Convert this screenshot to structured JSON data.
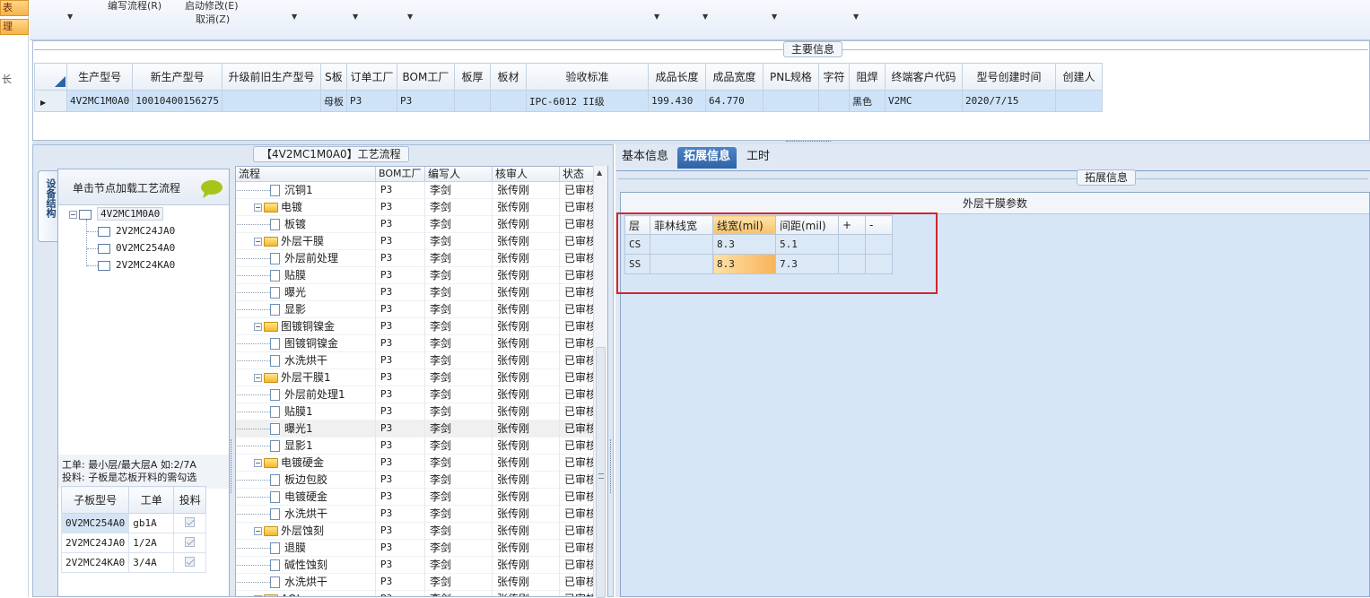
{
  "left_strip": {
    "item1": "表",
    "item2": "理",
    "item3": "长"
  },
  "toolbar": {
    "edit_flow": "编写流程(R)",
    "start_modify": "启动修改(E)",
    "cancel": "取消(Z)"
  },
  "main_info": {
    "title": "主要信息",
    "columns": [
      "生产型号",
      "新生产型号",
      "升级前旧生产型号",
      "S板",
      "订单工厂",
      "BOM工厂",
      "板厚",
      "板材",
      "验收标准",
      "成品长度",
      "成品宽度",
      "PNL规格",
      "字符",
      "阻焊",
      "终端客户代码",
      "型号创建时间",
      "创建人"
    ],
    "row": [
      "4V2MC1M0A0",
      "10010400156275",
      "",
      "母板",
      "P3",
      "P3",
      "",
      "",
      "IPC-6012 II级",
      "199.430",
      "64.770",
      "",
      "",
      "黑色",
      "V2MC",
      "2020/7/15",
      ""
    ]
  },
  "side_tab": "设备结构",
  "tree": {
    "load_button": "单击节点加载工艺流程",
    "root": "4V2MC1M0A0",
    "children": [
      "2V2MC24JA0",
      "0V2MC254A0",
      "2V2MC24KA0"
    ],
    "note_line1": "工单: 最小层/最大层A 如:2/7A",
    "note_line2": "投料: 子板是芯板开料的需勾选"
  },
  "sub_grid": {
    "headers": [
      "子板型号",
      "工单",
      "投料"
    ],
    "rows": [
      {
        "model": "0V2MC254A0",
        "order": "gb1A",
        "feed": true
      },
      {
        "model": "2V2MC24JA0",
        "order": "1/2A",
        "feed": true
      },
      {
        "model": "2V2MC24KA0",
        "order": "3/4A",
        "feed": true
      }
    ]
  },
  "process": {
    "title": "【4V2MC1M0A0】工艺流程",
    "headers": [
      "流程",
      "BOM工厂",
      "编写人",
      "核审人",
      "状态"
    ],
    "rows": [
      {
        "name": "沉铜1",
        "folder": false,
        "bom": "P3",
        "writer": "李剑",
        "reviewer": "张传刚",
        "status": "已审核"
      },
      {
        "name": "电镀",
        "folder": true,
        "bom": "P3",
        "writer": "李剑",
        "reviewer": "张传刚",
        "status": "已审核"
      },
      {
        "name": "板镀",
        "folder": false,
        "bom": "P3",
        "writer": "李剑",
        "reviewer": "张传刚",
        "status": "已审核"
      },
      {
        "name": "外层干膜",
        "folder": true,
        "bom": "P3",
        "writer": "李剑",
        "reviewer": "张传刚",
        "status": "已审核"
      },
      {
        "name": "外层前处理",
        "folder": false,
        "bom": "P3",
        "writer": "李剑",
        "reviewer": "张传刚",
        "status": "已审核"
      },
      {
        "name": "贴膜",
        "folder": false,
        "bom": "P3",
        "writer": "李剑",
        "reviewer": "张传刚",
        "status": "已审核"
      },
      {
        "name": "曝光",
        "folder": false,
        "bom": "P3",
        "writer": "李剑",
        "reviewer": "张传刚",
        "status": "已审核"
      },
      {
        "name": "显影",
        "folder": false,
        "bom": "P3",
        "writer": "李剑",
        "reviewer": "张传刚",
        "status": "已审核"
      },
      {
        "name": "图镀铜镍金",
        "folder": true,
        "bom": "P3",
        "writer": "李剑",
        "reviewer": "张传刚",
        "status": "已审核"
      },
      {
        "name": "图镀铜镍金",
        "folder": false,
        "bom": "P3",
        "writer": "李剑",
        "reviewer": "张传刚",
        "status": "已审核"
      },
      {
        "name": "水洗烘干",
        "folder": false,
        "bom": "P3",
        "writer": "李剑",
        "reviewer": "张传刚",
        "status": "已审核"
      },
      {
        "name": "外层干膜1",
        "folder": true,
        "bom": "P3",
        "writer": "李剑",
        "reviewer": "张传刚",
        "status": "已审核"
      },
      {
        "name": "外层前处理1",
        "folder": false,
        "bom": "P3",
        "writer": "李剑",
        "reviewer": "张传刚",
        "status": "已审核"
      },
      {
        "name": "贴膜1",
        "folder": false,
        "bom": "P3",
        "writer": "李剑",
        "reviewer": "张传刚",
        "status": "已审核"
      },
      {
        "name": "曝光1",
        "folder": false,
        "bom": "P3",
        "writer": "李剑",
        "reviewer": "张传刚",
        "status": "已审核"
      },
      {
        "name": "显影1",
        "folder": false,
        "bom": "P3",
        "writer": "李剑",
        "reviewer": "张传刚",
        "status": "已审核"
      },
      {
        "name": "电镀硬金",
        "folder": true,
        "bom": "P3",
        "writer": "李剑",
        "reviewer": "张传刚",
        "status": "已审核"
      },
      {
        "name": "板边包胶",
        "folder": false,
        "bom": "P3",
        "writer": "李剑",
        "reviewer": "张传刚",
        "status": "已审核"
      },
      {
        "name": "电镀硬金",
        "folder": false,
        "bom": "P3",
        "writer": "李剑",
        "reviewer": "张传刚",
        "status": "已审核"
      },
      {
        "name": "水洗烘干",
        "folder": false,
        "bom": "P3",
        "writer": "李剑",
        "reviewer": "张传刚",
        "status": "已审核"
      },
      {
        "name": "外层蚀刻",
        "folder": true,
        "bom": "P3",
        "writer": "李剑",
        "reviewer": "张传刚",
        "status": "已审核"
      },
      {
        "name": "退膜",
        "folder": false,
        "bom": "P3",
        "writer": "李剑",
        "reviewer": "张传刚",
        "status": "已审核"
      },
      {
        "name": "碱性蚀刻",
        "folder": false,
        "bom": "P3",
        "writer": "李剑",
        "reviewer": "张传刚",
        "status": "已审核"
      },
      {
        "name": "水洗烘干",
        "folder": false,
        "bom": "P3",
        "writer": "李剑",
        "reviewer": "张传刚",
        "status": "已审核"
      },
      {
        "name": "AOI",
        "folder": true,
        "bom": "P3",
        "writer": "李剑",
        "reviewer": "张传刚",
        "status": "已审核"
      }
    ],
    "selected_index": 14
  },
  "right_tabs": [
    "基本信息",
    "拓展信息",
    "工时"
  ],
  "extension": {
    "title": "拓展信息",
    "panel_title": "外层干膜参数",
    "headers": [
      "层",
      "菲林线宽",
      "线宽(mil)",
      "间距(mil)",
      "+",
      "-"
    ],
    "rows": [
      [
        "CS",
        "",
        "8.3",
        "5.1",
        "",
        ""
      ],
      [
        "SS",
        "",
        "8.3",
        "7.3",
        "",
        ""
      ]
    ]
  }
}
